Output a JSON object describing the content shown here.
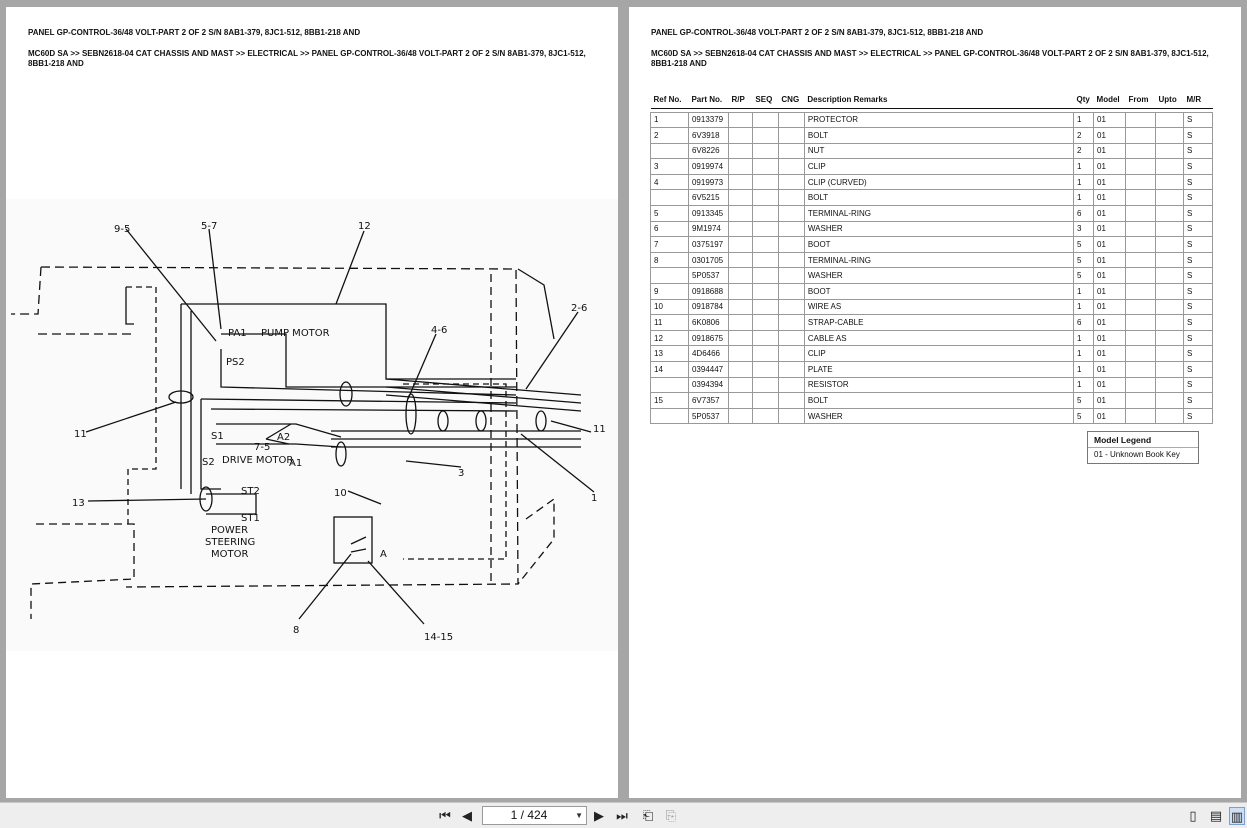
{
  "header": {
    "line1": "PANEL GP-CONTROL-36/48 VOLT-PART 2 OF 2 S/N 8AB1-379, 8JC1-512, 8BB1-218 AND",
    "line2": "MC60D SA >> SEBN2618-04 CAT CHASSIS AND MAST >> ELECTRICAL >> PANEL GP-CONTROL-36/48 VOLT-PART 2 OF 2 S/N 8AB1-379, 8JC1-512, 8BB1-218 AND"
  },
  "diagram": {
    "labels": {
      "c95": "9-5",
      "c57": "5-7",
      "c12": "12",
      "c26": "2-6",
      "c46": "4-6",
      "c11a": "11",
      "c11b": "11",
      "c75": "7-5",
      "c3": "3",
      "c1": "1",
      "c13": "13",
      "c10": "10",
      "c8": "8",
      "c1415": "14-15",
      "pa1": "PA1",
      "pump": "PUMP MOTOR",
      "ps2": "PS2",
      "s1": "S1",
      "s2": "S2",
      "drive": "DRIVE MOTOR",
      "a2": "A2",
      "a1": "A1",
      "st2": "ST2",
      "st1": "ST1",
      "power": "POWER",
      "steering": "STEERING",
      "motor": "MOTOR",
      "a": "A"
    }
  },
  "table": {
    "columns": [
      "Ref No.",
      "Part No.",
      "R/P",
      "SEQ",
      "CNG",
      "Description Remarks",
      "Qty",
      "Model",
      "From",
      "Upto",
      "M/R"
    ],
    "rows": [
      [
        "1",
        "0913379",
        "",
        "",
        "",
        "PROTECTOR",
        "1",
        "01",
        "",
        "",
        "S"
      ],
      [
        "2",
        "6V3918",
        "",
        "",
        "",
        "BOLT",
        "2",
        "01",
        "",
        "",
        "S"
      ],
      [
        "",
        "6V8226",
        "",
        "",
        "",
        "NUT",
        "2",
        "01",
        "",
        "",
        "S"
      ],
      [
        "3",
        "0919974",
        "",
        "",
        "",
        "CLIP",
        "1",
        "01",
        "",
        "",
        "S"
      ],
      [
        "4",
        "0919973",
        "",
        "",
        "",
        "CLIP (CURVED)",
        "1",
        "01",
        "",
        "",
        "S"
      ],
      [
        "",
        "6V5215",
        "",
        "",
        "",
        "BOLT",
        "1",
        "01",
        "",
        "",
        "S"
      ],
      [
        "5",
        "0913345",
        "",
        "",
        "",
        "TERMINAL-RING",
        "6",
        "01",
        "",
        "",
        "S"
      ],
      [
        "6",
        "9M1974",
        "",
        "",
        "",
        "WASHER",
        "3",
        "01",
        "",
        "",
        "S"
      ],
      [
        "7",
        "0375197",
        "",
        "",
        "",
        "BOOT",
        "5",
        "01",
        "",
        "",
        "S"
      ],
      [
        "8",
        "0301705",
        "",
        "",
        "",
        "TERMINAL-RING",
        "5",
        "01",
        "",
        "",
        "S"
      ],
      [
        "",
        "5P0537",
        "",
        "",
        "",
        "WASHER",
        "5",
        "01",
        "",
        "",
        "S"
      ],
      [
        "9",
        "0918688",
        "",
        "",
        "",
        "BOOT",
        "1",
        "01",
        "",
        "",
        "S"
      ],
      [
        "10",
        "0918784",
        "",
        "",
        "",
        "WIRE AS",
        "1",
        "01",
        "",
        "",
        "S"
      ],
      [
        "11",
        "6K0806",
        "",
        "",
        "",
        "STRAP-CABLE",
        "6",
        "01",
        "",
        "",
        "S"
      ],
      [
        "12",
        "0918675",
        "",
        "",
        "",
        "CABLE AS",
        "1",
        "01",
        "",
        "",
        "S"
      ],
      [
        "13",
        "4D6466",
        "",
        "",
        "",
        "CLIP",
        "1",
        "01",
        "",
        "",
        "S"
      ],
      [
        "14",
        "0394447",
        "",
        "",
        "",
        "PLATE",
        "1",
        "01",
        "",
        "",
        "S"
      ],
      [
        "",
        "0394394",
        "",
        "",
        "",
        "RESISTOR",
        "1",
        "01",
        "",
        "",
        "S"
      ],
      [
        "15",
        "6V7357",
        "",
        "",
        "",
        "BOLT",
        "5",
        "01",
        "",
        "",
        "S"
      ],
      [
        "",
        "5P0537",
        "",
        "",
        "",
        "WASHER",
        "5",
        "01",
        "",
        "",
        "S"
      ]
    ]
  },
  "legend": {
    "title": "Model Legend",
    "entry": "01 - Unknown Book Key"
  },
  "toolbar": {
    "page_display": "1 / 424"
  }
}
